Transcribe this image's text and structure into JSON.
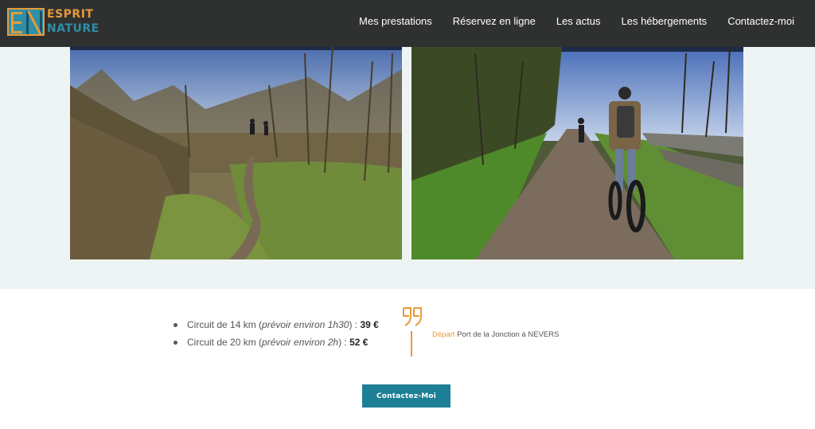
{
  "logo": {
    "line1": "ESPRIT",
    "line2": "NATURE"
  },
  "nav": {
    "items": [
      {
        "label": "Mes prestations"
      },
      {
        "label": "Réservez en ligne"
      },
      {
        "label": "Les actus"
      },
      {
        "label": "Les hébergements"
      },
      {
        "label": "Contactez-moi"
      }
    ]
  },
  "prices": [
    {
      "prefix": "Circuit de 14 km (",
      "note": "prévoir environ 1h30",
      "suffix": ") : ",
      "price": "39 €"
    },
    {
      "prefix": "Circuit de 20 km (",
      "note": "prévoir environ 2h",
      "suffix": ") : ",
      "price": "52 €"
    }
  ],
  "depart": {
    "highlight": "Départ",
    "text": " Port de la Jonction à NEVERS"
  },
  "cta": {
    "label": "Contactez-Moi"
  },
  "colors": {
    "header": "#2f3131",
    "accent": "#e79a3b",
    "brand": "#1c7f96",
    "band": "#eef4f3"
  },
  "icons": {
    "quote": "quote-icon"
  }
}
